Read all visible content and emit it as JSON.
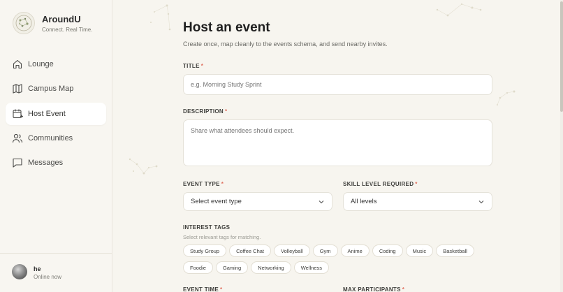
{
  "brand": {
    "name": "AroundU",
    "tagline": "Connect. Real Time.",
    "logo_icon": "constellation-globe-icon"
  },
  "nav": {
    "items": [
      {
        "label": "Lounge",
        "icon": "home-icon",
        "active": false
      },
      {
        "label": "Campus Map",
        "icon": "map-icon",
        "active": false
      },
      {
        "label": "Host Event",
        "icon": "calendar-plus-icon",
        "active": true
      },
      {
        "label": "Communities",
        "icon": "users-icon",
        "active": false
      },
      {
        "label": "Messages",
        "icon": "chat-icon",
        "active": false
      }
    ]
  },
  "user": {
    "name": "he",
    "status": "Online now"
  },
  "page": {
    "title": "Host an event",
    "subtitle": "Create once, map cleanly to the events schema, and send nearby invites."
  },
  "form": {
    "title": {
      "label": "TITLE",
      "placeholder": "e.g. Morning Study Sprint"
    },
    "description": {
      "label": "DESCRIPTION",
      "placeholder": "Share what attendees should expect."
    },
    "event_type": {
      "label": "EVENT TYPE",
      "value": "Select event type"
    },
    "skill_level": {
      "label": "SKILL LEVEL REQUIRED",
      "value": "All levels"
    },
    "interest_tags": {
      "label": "INTEREST TAGS",
      "helper": "Select relevant tags for matching.",
      "tags": [
        "Study Group",
        "Coffee Chat",
        "Volleyball",
        "Gym",
        "Anime",
        "Coding",
        "Music",
        "Basketball",
        "Foodie",
        "Gaming",
        "Networking",
        "Wellness"
      ]
    },
    "event_time": {
      "label": "EVENT TIME"
    },
    "max_participants": {
      "label": "MAX PARTICIPANTS"
    },
    "required_marker": "*"
  },
  "colors": {
    "accent_required": "#e0705f",
    "background": "#f7f5ef",
    "sidebar_active": "#ffffff"
  }
}
